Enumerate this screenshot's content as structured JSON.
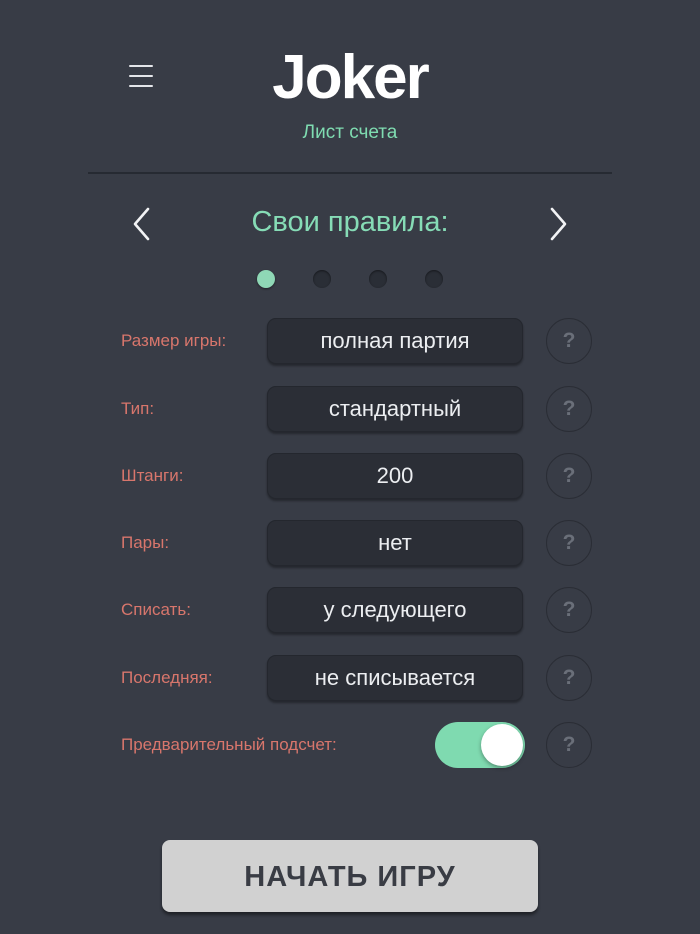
{
  "header": {
    "app_title": "Joker",
    "subtitle": "Лист счета",
    "menu_icon": "hamburger-menu-icon"
  },
  "ruleset": {
    "title": "Свои правила:",
    "prev_icon": "chevron-left-icon",
    "next_icon": "chevron-right-icon",
    "page_count": 4,
    "active_page": 1
  },
  "settings": [
    {
      "label": "Размер игры:",
      "value": "полная партия",
      "help": "?"
    },
    {
      "label": "Тип:",
      "value": "стандартный",
      "help": "?"
    },
    {
      "label": "Штанги:",
      "value": "200",
      "help": "?"
    },
    {
      "label": "Пары:",
      "value": "нет",
      "help": "?"
    },
    {
      "label": "Списать:",
      "value": "у следующего",
      "help": "?"
    },
    {
      "label": "Последняя:",
      "value": "не списывается",
      "help": "?"
    }
  ],
  "pre_count": {
    "label": "Предварительный подсчет:",
    "enabled": true,
    "help": "?"
  },
  "start_button": {
    "label": "НАЧАТЬ ИГРУ"
  },
  "colors": {
    "background": "#383c46",
    "accent_green": "#7fdab0",
    "label_red": "#d8766c",
    "field_bg": "#2b2e36"
  }
}
